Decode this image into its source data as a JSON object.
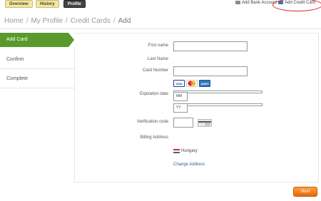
{
  "top_tabs": [
    "Overview",
    "History",
    "Profile"
  ],
  "top_links": {
    "add_bank_account": "Add Bank Account",
    "add_credit_card": "Add Credit Card"
  },
  "breadcrumb": [
    "Home",
    "My Profile",
    "Credit Cards",
    "Add"
  ],
  "breadcrumb_sep": "/",
  "steps": [
    "Add Card",
    "Confirm",
    "Complete"
  ],
  "form": {
    "first_name_label": "First name",
    "last_name_label": "Last Name",
    "card_number_label": "Card Number",
    "expiration_label": "Expiration date",
    "month_placeholder": "MM",
    "year_placeholder": "YY",
    "verification_label": "Verification code",
    "billing_label": "Billing Address",
    "country": "Hungary",
    "change_address": "Change Address",
    "card_logos": [
      "VISA",
      "MasterCard",
      "AMEX"
    ]
  },
  "next_button": "Next",
  "colors": {
    "step_active": "#5a9a2c",
    "next_button": "#f08a24",
    "highlight_oval": "#d42a2a",
    "link": "#2b5f9e"
  }
}
